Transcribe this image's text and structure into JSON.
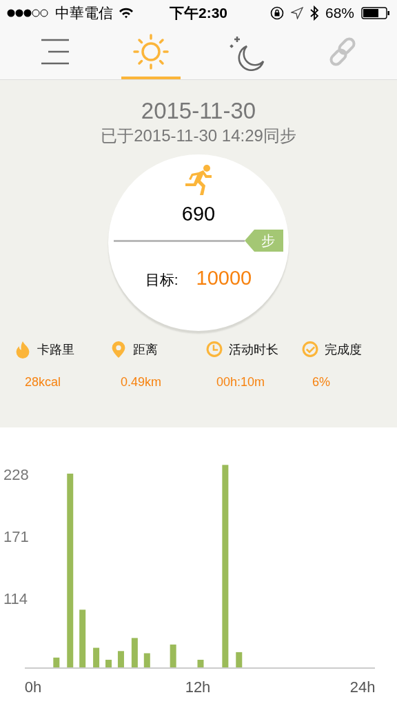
{
  "status_bar": {
    "carrier": "中華電信",
    "time": "下午2:30",
    "battery": "68%"
  },
  "tabs": [
    {
      "kind": "menu",
      "selected": false
    },
    {
      "kind": "day",
      "selected": true
    },
    {
      "kind": "night",
      "selected": false
    },
    {
      "kind": "link",
      "selected": false
    }
  ],
  "summary": {
    "date": "2015-11-30",
    "sync_text": "已于2015-11-30 14:29同步",
    "steps": "690",
    "unit": "步",
    "goal_label": "目标:",
    "goal": "10000"
  },
  "stats": [
    {
      "kind": "calories",
      "label": "卡路里",
      "value": "28kcal"
    },
    {
      "kind": "distance",
      "label": "距离",
      "value": "0.49km"
    },
    {
      "kind": "duration",
      "label": "活动时长",
      "value": "00h:10m"
    },
    {
      "kind": "completion",
      "label": "完成度",
      "value": "6%"
    }
  ],
  "chart": {
    "chart_data": {
      "type": "bar",
      "x": [
        1.7,
        2.7,
        3.6,
        4.6,
        5.5,
        6.4,
        7.4,
        8.3,
        10.2,
        12.2,
        14.0,
        15.0
      ],
      "series": [
        {
          "color": "#9bbb59",
          "values": [
            59,
            228,
            103,
            68,
            57,
            65,
            77,
            63,
            71,
            57,
            236,
            64
          ]
        }
      ],
      "xlim": [
        -0.6,
        24.9
      ],
      "ylim": [
        50,
        240
      ],
      "xticks": [
        {
          "value": 0,
          "label": "0h"
        },
        {
          "value": 12,
          "label": "12h"
        },
        {
          "value": 24,
          "label": "24h"
        }
      ],
      "yticks": [
        114,
        171,
        228
      ]
    }
  }
}
